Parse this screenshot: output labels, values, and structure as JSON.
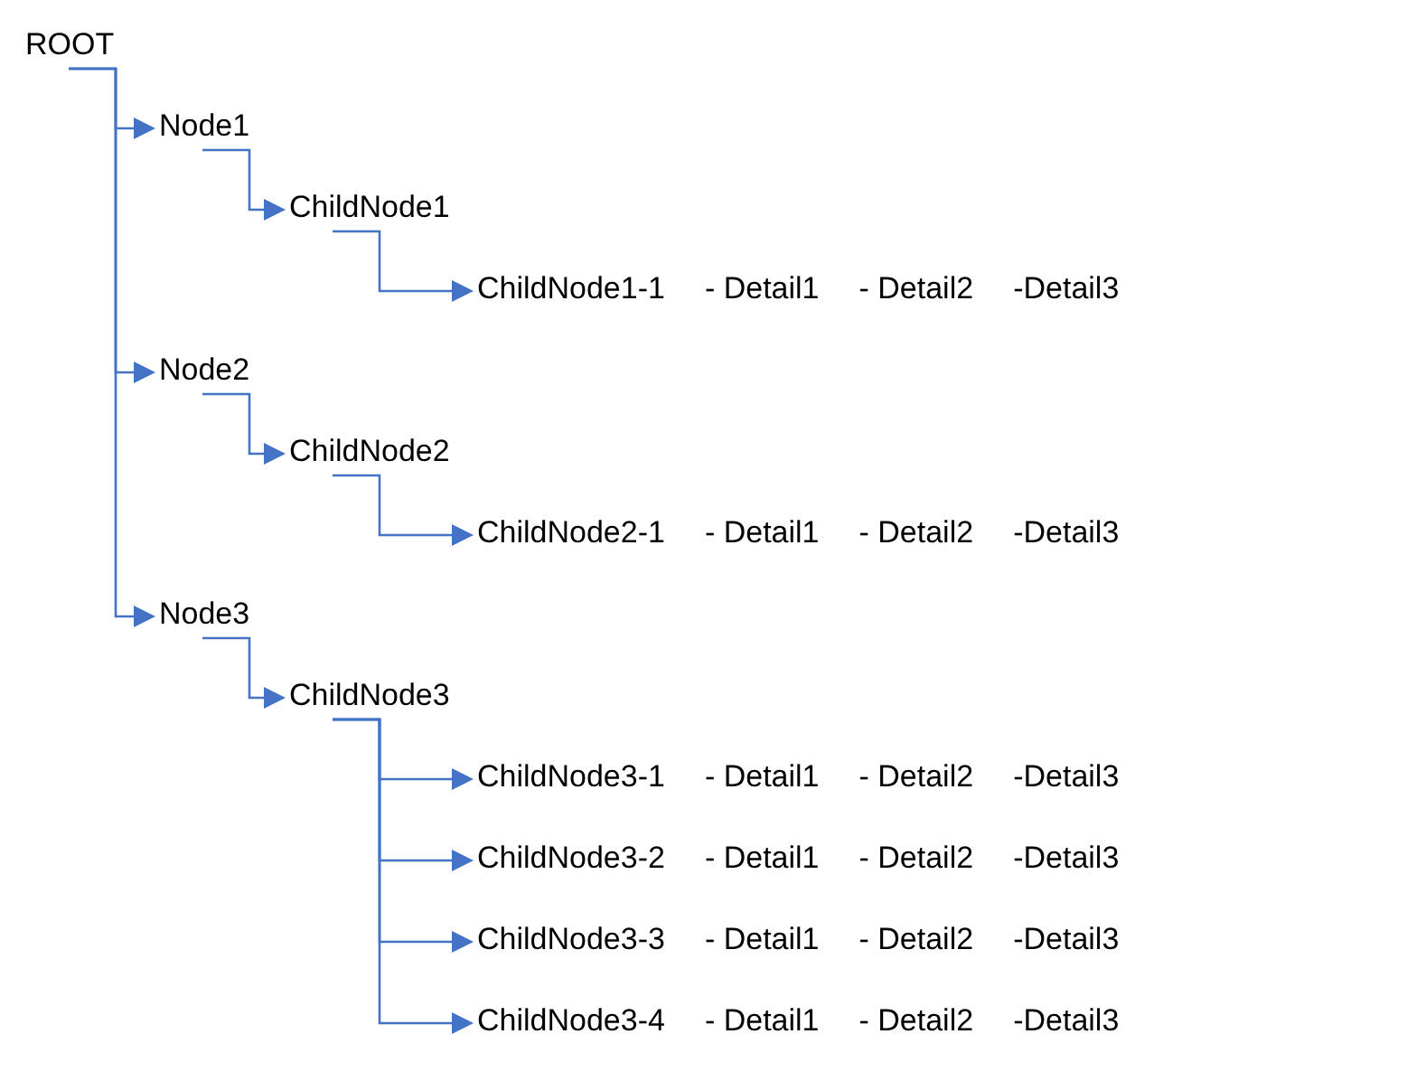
{
  "tree": {
    "label": "ROOT",
    "children": [
      {
        "label": "Node1",
        "children": [
          {
            "label": "ChildNode1",
            "children": [
              {
                "label": "ChildNode1-1",
                "details": [
                  "- Detail1",
                  "- Detail2",
                  "-Detail3"
                ]
              }
            ]
          }
        ]
      },
      {
        "label": "Node2",
        "children": [
          {
            "label": "ChildNode2",
            "children": [
              {
                "label": "ChildNode2-1",
                "details": [
                  "- Detail1",
                  "- Detail2",
                  "-Detail3"
                ]
              }
            ]
          }
        ]
      },
      {
        "label": "Node3",
        "children": [
          {
            "label": "ChildNode3",
            "children": [
              {
                "label": "ChildNode3-1",
                "details": [
                  "- Detail1",
                  "- Detail2",
                  "-Detail3"
                ]
              },
              {
                "label": "ChildNode3-2",
                "details": [
                  "- Detail1",
                  "- Detail2",
                  "-Detail3"
                ]
              },
              {
                "label": "ChildNode3-3",
                "details": [
                  "- Detail1",
                  "- Detail2",
                  "-Detail3"
                ]
              },
              {
                "label": "ChildNode3-4",
                "details": [
                  "- Detail1",
                  "- Detail2",
                  "-Detail3"
                ]
              }
            ]
          }
        ]
      }
    ]
  }
}
